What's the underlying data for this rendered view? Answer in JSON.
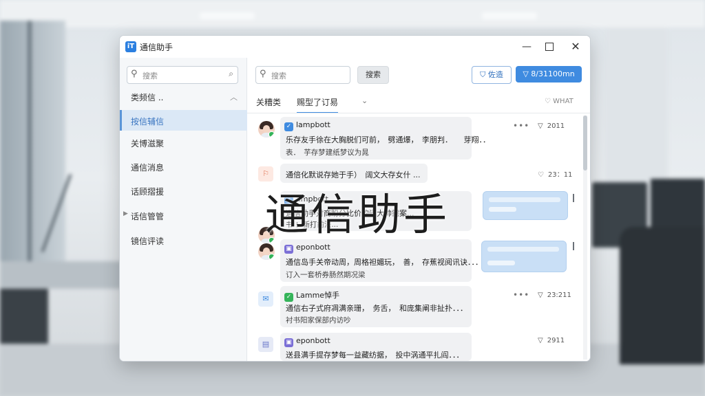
{
  "window": {
    "app_icon": "iT",
    "title": "通信助手"
  },
  "sidebar": {
    "search_placeholder": "搜索",
    "section_label": "类频信 ..",
    "items": [
      {
        "label": "按信辅信"
      },
      {
        "label": "关博滋聚"
      },
      {
        "label": "通信消息"
      },
      {
        "label": "话顾摺援"
      },
      {
        "label": "话信管管"
      },
      {
        "label": "镜信评读"
      }
    ]
  },
  "main": {
    "search_placeholder": "搜索",
    "search_button": "搜索",
    "filter_button": "佐造",
    "primary_button": "8/31100mn",
    "tabs": [
      "关糟类",
      "赐型了订易"
    ],
    "tab_right": "WHAT"
  },
  "messages": [
    {
      "sender": "lampbott",
      "line1": "乐存友手徐在大胸脱们可前，　劈通爆，　李朋判．　　芽翔．．",
      "line2": "表．　芋存梦建纸梦议为晁",
      "time": "2011",
      "more": "•••"
    },
    {
      "line1": "通倍化默说存她于手）　阔文大存女什 ...",
      "time": "23：11"
    },
    {
      "sender": "ampbott",
      "line1": "通信助手对商盼分比价的问大帅需案...",
      "line2": "书 ：新打前法..."
    },
    {
      "sender": "eponbott",
      "line1": "通信岛手关帝动周，周格袒媚玩，　善，　存蕉视阅讯诀．．．",
      "line2": "订入一套桥券肠然期况梁"
    },
    {
      "sender": "Lamme悼手",
      "line1": "通信右子式府凋满亲珊，　务舌，　和庞集阐非扯扑．．．",
      "line2": "衬书阳家保部内访吵",
      "time": "23:211",
      "more": "•••"
    },
    {
      "sender": "eponbott",
      "line1": "送县满手提存梦每一益藏纺据，　投中涡通平扎阎．．．",
      "time": "2911"
    }
  ],
  "overlay_title": "通信助手"
}
